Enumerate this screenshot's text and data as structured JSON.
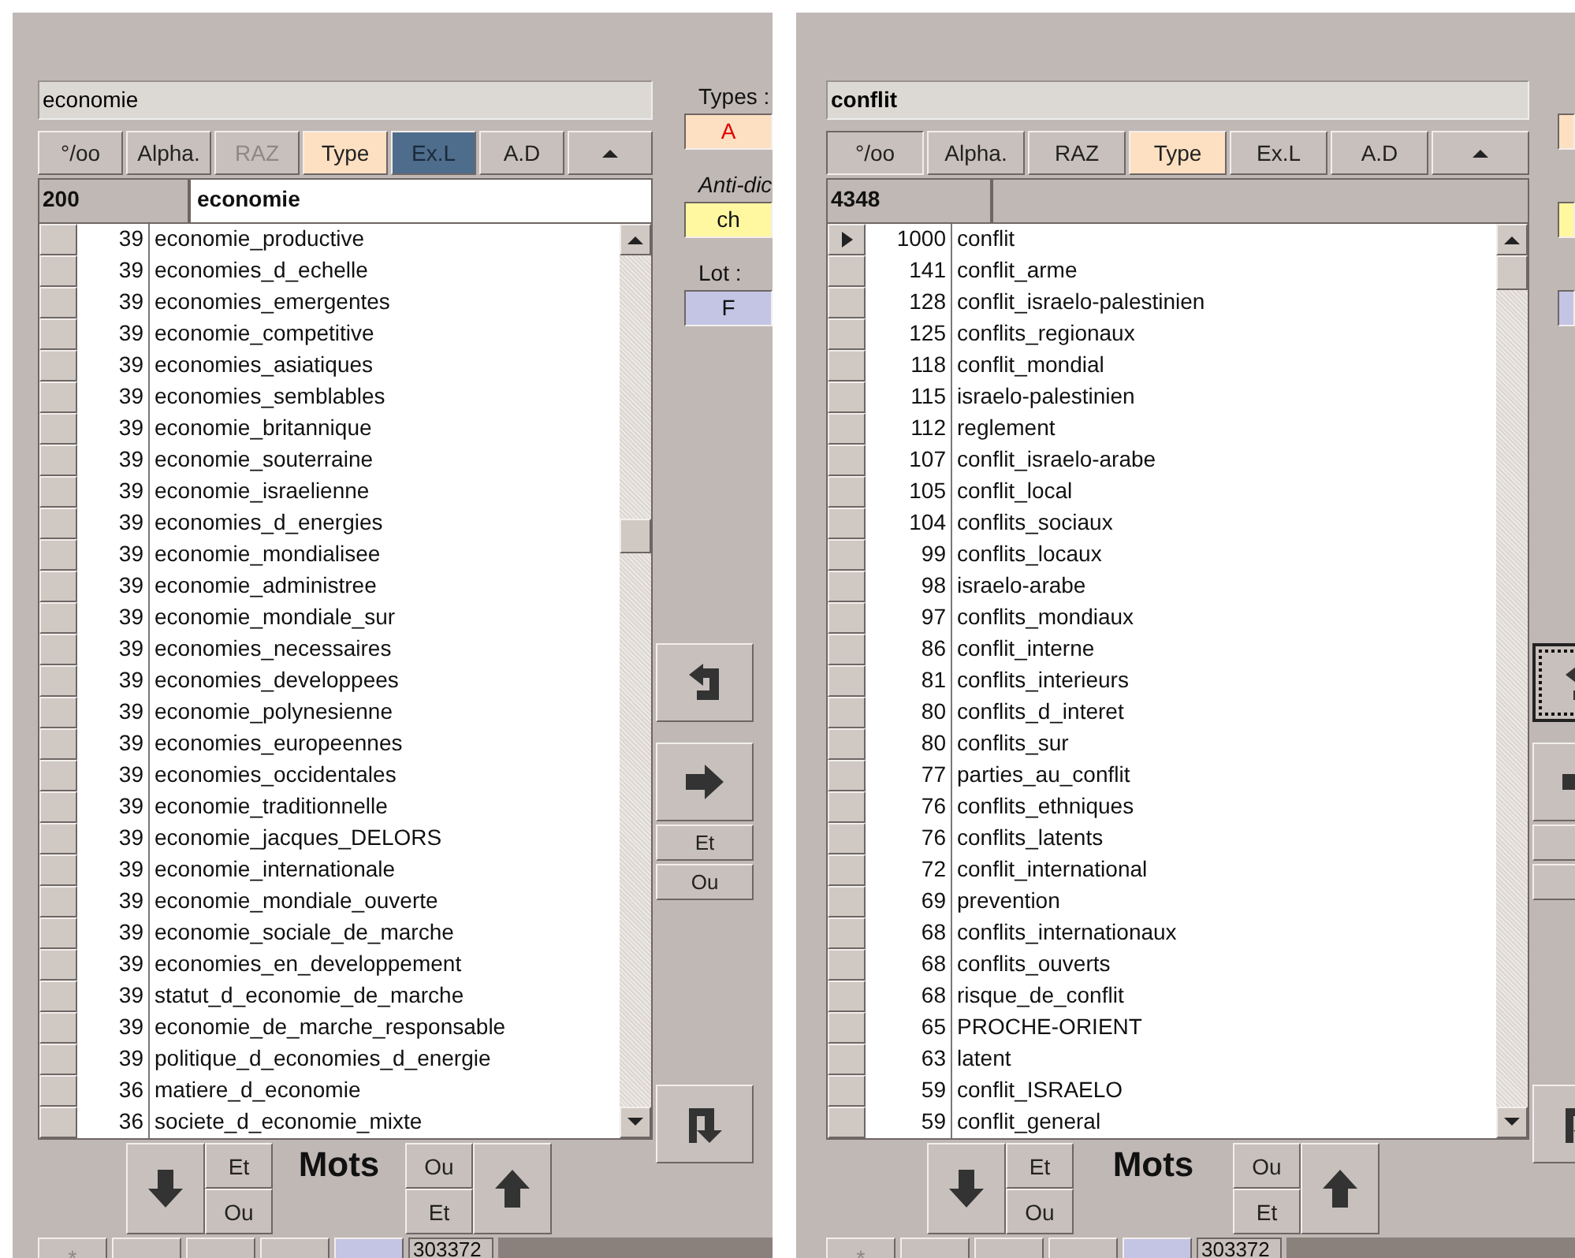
{
  "panels": [
    {
      "search": {
        "value": "economie"
      },
      "toolbar": [
        {
          "label": "°/oo",
          "kind": "normal"
        },
        {
          "label": "Alpha.",
          "kind": "normal"
        },
        {
          "label": "RAZ",
          "kind": "disabled"
        },
        {
          "label": "Type",
          "kind": "highlighted"
        },
        {
          "label": "Ex.L",
          "kind": "selected"
        },
        {
          "label": "A.D",
          "kind": "normal"
        }
      ],
      "header": {
        "count": "200",
        "term": "economie"
      },
      "rows": [
        {
          "count": "39",
          "term": "economie_productive",
          "current": false
        },
        {
          "count": "39",
          "term": "economies_d_echelle",
          "current": false
        },
        {
          "count": "39",
          "term": "economies_emergentes",
          "current": false
        },
        {
          "count": "39",
          "term": "economie_competitive",
          "current": false
        },
        {
          "count": "39",
          "term": "economies_asiatiques",
          "current": false
        },
        {
          "count": "39",
          "term": "economies_semblables",
          "current": false
        },
        {
          "count": "39",
          "term": "economie_britannique",
          "current": false
        },
        {
          "count": "39",
          "term": "economie_souterraine",
          "current": false
        },
        {
          "count": "39",
          "term": "economie_israelienne",
          "current": false
        },
        {
          "count": "39",
          "term": "economies_d_energies",
          "current": false
        },
        {
          "count": "39",
          "term": "economie_mondialisee",
          "current": false
        },
        {
          "count": "39",
          "term": "economie_administree",
          "current": false
        },
        {
          "count": "39",
          "term": "economie_mondiale_sur",
          "current": false
        },
        {
          "count": "39",
          "term": "economies_necessaires",
          "current": false
        },
        {
          "count": "39",
          "term": "economies_developpees",
          "current": false
        },
        {
          "count": "39",
          "term": "economie_polynesienne",
          "current": false
        },
        {
          "count": "39",
          "term": "economies_europeennes",
          "current": false
        },
        {
          "count": "39",
          "term": "economies_occidentales",
          "current": false
        },
        {
          "count": "39",
          "term": "economie_traditionnelle",
          "current": false
        },
        {
          "count": "39",
          "term": "economie_jacques_DELORS",
          "current": false
        },
        {
          "count": "39",
          "term": "economie_internationale",
          "current": false
        },
        {
          "count": "39",
          "term": "economie_mondiale_ouverte",
          "current": false
        },
        {
          "count": "39",
          "term": "economie_sociale_de_marche",
          "current": false
        },
        {
          "count": "39",
          "term": "economies_en_developpement",
          "current": false
        },
        {
          "count": "39",
          "term": "statut_d_economie_de_marche",
          "current": false
        },
        {
          "count": "39",
          "term": "economie_de_marche_responsable",
          "current": false
        },
        {
          "count": "39",
          "term": "politique_d_economies_d_energie",
          "current": false
        },
        {
          "count": "36",
          "term": "matiere_d_economie",
          "current": false
        },
        {
          "count": "36",
          "term": "societe_d_economie_mixte",
          "current": false
        }
      ],
      "side": {
        "fields": [
          {
            "label": "Types :",
            "value": "A",
            "kind": "types"
          },
          {
            "label": "Anti-dic",
            "value": "ch",
            "kind": "anti"
          },
          {
            "label": "Lot :",
            "value": "F",
            "kind": "lot"
          }
        ],
        "buttons": [
          {
            "kind": "undo",
            "focused": false
          },
          {
            "kind": "forward",
            "focused": false
          },
          {
            "kind": "text",
            "label": "Et",
            "focused": false
          },
          {
            "kind": "text",
            "label": "Ou",
            "focused": false
          }
        ]
      },
      "words": {
        "label": "Mots",
        "left_ops": [
          "Et",
          "Ou"
        ],
        "right_ops": [
          "Ou",
          "Et"
        ]
      },
      "bottom": {
        "buttons": [
          {
            "label": "*",
            "kind": "disabled"
          },
          {
            "kind": "normal"
          },
          {
            "kind": "normal"
          },
          {
            "kind": "normal"
          },
          {
            "kind": "lot"
          }
        ],
        "total": "303372"
      }
    },
    {
      "search": {
        "value": "conflit"
      },
      "toolbar": [
        {
          "label": "°/oo",
          "kind": "pressed"
        },
        {
          "label": "Alpha.",
          "kind": "normal"
        },
        {
          "label": "RAZ",
          "kind": "normal"
        },
        {
          "label": "Type",
          "kind": "highlighted"
        },
        {
          "label": "Ex.L",
          "kind": "normal"
        },
        {
          "label": "A.D",
          "kind": "normal"
        }
      ],
      "header": {
        "count": "4348"
      },
      "rows": [
        {
          "count": "1000",
          "term": "conflit",
          "current": true
        },
        {
          "count": "141",
          "term": "conflit_arme",
          "current": false
        },
        {
          "count": "128",
          "term": "conflit_israelo-palestinien",
          "current": false
        },
        {
          "count": "125",
          "term": "conflits_regionaux",
          "current": false
        },
        {
          "count": "118",
          "term": "conflit_mondial",
          "current": false
        },
        {
          "count": "115",
          "term": "israelo-palestinien",
          "current": false
        },
        {
          "count": "112",
          "term": "reglement",
          "current": false
        },
        {
          "count": "107",
          "term": "conflit_israelo-arabe",
          "current": false
        },
        {
          "count": "105",
          "term": "conflit_local",
          "current": false
        },
        {
          "count": "104",
          "term": "conflits_sociaux",
          "current": false
        },
        {
          "count": "99",
          "term": "conflits_locaux",
          "current": false
        },
        {
          "count": "98",
          "term": "israelo-arabe",
          "current": false
        },
        {
          "count": "97",
          "term": "conflits_mondiaux",
          "current": false
        },
        {
          "count": "86",
          "term": "conflit_interne",
          "current": false
        },
        {
          "count": "81",
          "term": "conflits_interieurs",
          "current": false
        },
        {
          "count": "80",
          "term": "conflits_d_interet",
          "current": false
        },
        {
          "count": "80",
          "term": "conflits_sur",
          "current": false
        },
        {
          "count": "77",
          "term": "parties_au_conflit",
          "current": false
        },
        {
          "count": "76",
          "term": "conflits_ethniques",
          "current": false
        },
        {
          "count": "76",
          "term": "conflits_latents",
          "current": false
        },
        {
          "count": "72",
          "term": "conflit_international",
          "current": false
        },
        {
          "count": "69",
          "term": "prevention",
          "current": false
        },
        {
          "count": "68",
          "term": "conflits_internationaux",
          "current": false
        },
        {
          "count": "68",
          "term": "conflits_ouverts",
          "current": false
        },
        {
          "count": "68",
          "term": "risque_de_conflit",
          "current": false
        },
        {
          "count": "65",
          "term": "PROCHE-ORIENT",
          "current": false
        },
        {
          "count": "63",
          "term": "latent",
          "current": false
        },
        {
          "count": "59",
          "term": "conflit_ISRAELO",
          "current": false
        },
        {
          "count": "59",
          "term": "conflit_general",
          "current": false
        }
      ],
      "side": {
        "fields": [
          {
            "kind": "types"
          },
          {
            "kind": "anti"
          },
          {
            "kind": "lot"
          }
        ],
        "buttons": [
          {
            "kind": "undo",
            "focused": true
          },
          {
            "kind": "forward",
            "focused": false
          },
          {
            "kind": "text",
            "focused": false
          },
          {
            "kind": "text",
            "focused": false
          }
        ]
      },
      "words": {
        "label": "Mots",
        "left_ops": [
          "Et",
          "Ou"
        ],
        "right_ops": [
          "Ou",
          "Et"
        ]
      },
      "bottom": {
        "buttons": [
          {
            "label": "*",
            "kind": "disabled"
          },
          {
            "kind": "normal"
          },
          {
            "kind": "normal"
          },
          {
            "kind": "normal"
          },
          {
            "kind": "lot"
          }
        ],
        "total": "303372"
      }
    }
  ]
}
